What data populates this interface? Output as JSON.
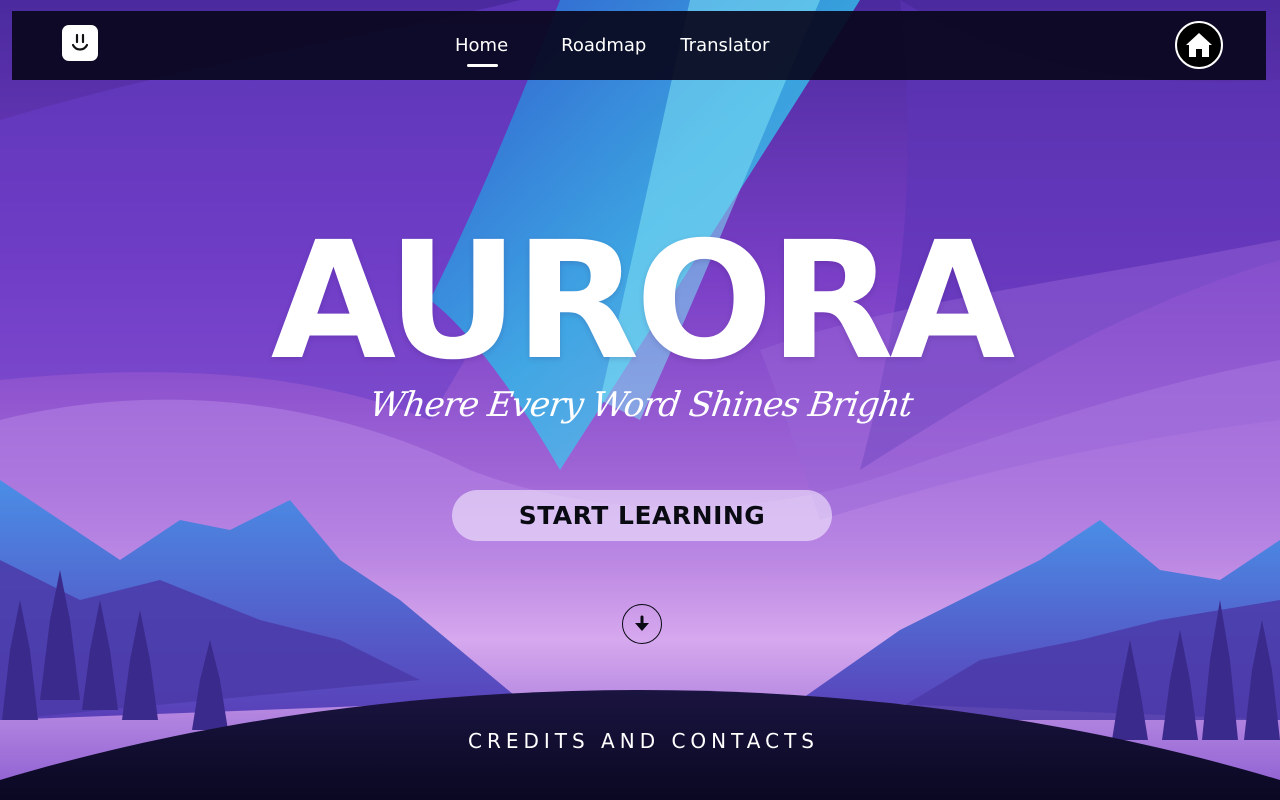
{
  "nav": {
    "logo_icon": "smiley-icon",
    "links": [
      {
        "label": "Home",
        "active": true
      },
      {
        "label": "Roadmap",
        "active": false
      },
      {
        "label": "Translator",
        "active": false
      }
    ],
    "home_icon": "home-icon"
  },
  "hero": {
    "title": "AURORA",
    "tagline": "Where Every Word Shines Bright",
    "cta_label": "START LEARNING",
    "scroll_icon": "arrow-down-icon"
  },
  "footer": {
    "credits_label": "CREDITS AND CONTACTS"
  },
  "colors": {
    "nav_bg": "#08061c",
    "accent_white": "#ffffff",
    "sky_purple": "#8a4fd0",
    "aurora_blue": "#3aa0e0",
    "cta_bg": "#f5ebff"
  }
}
